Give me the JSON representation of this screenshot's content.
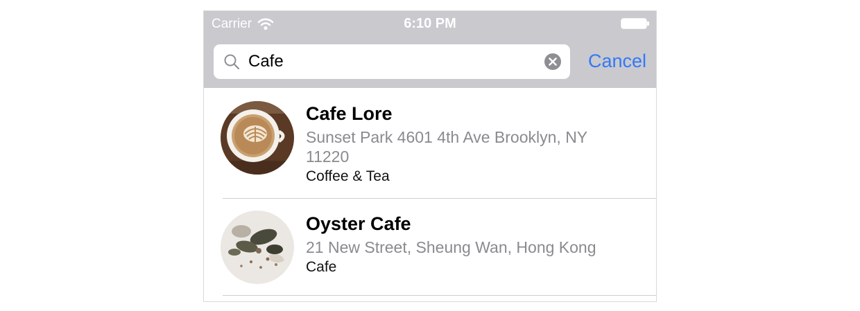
{
  "status_bar": {
    "carrier": "Carrier",
    "time": "6:10 PM",
    "wifi_icon": "wifi-icon",
    "battery_icon": "battery-icon"
  },
  "search": {
    "value": "Cafe",
    "placeholder": "",
    "search_icon": "search-icon",
    "clear_icon": "clear-icon",
    "cancel_label": "Cancel"
  },
  "colors": {
    "header_background": "#c9c9ce",
    "accent": "#3478f6",
    "secondary_text": "#8a8a8f"
  },
  "results": [
    {
      "name": "Cafe Lore",
      "address": "Sunset Park 4601 4th Ave Brooklyn, NY 11220",
      "category": "Coffee & Tea",
      "thumbnail": "latte-art-photo"
    },
    {
      "name": "Oyster Cafe",
      "address": "21 New Street, Sheung Wan, Hong Kong",
      "category": "Cafe",
      "thumbnail": "oyster-dish-photo"
    }
  ]
}
